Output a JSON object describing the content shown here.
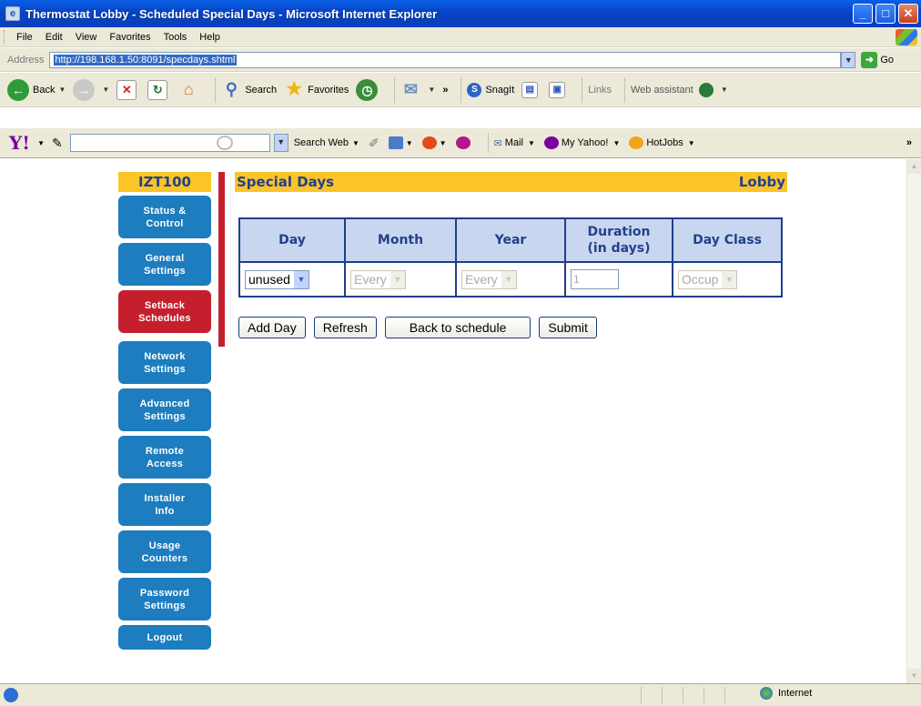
{
  "window": {
    "title": "Thermostat Lobby - Scheduled Special Days - Microsoft Internet Explorer"
  },
  "menu": [
    "File",
    "Edit",
    "View",
    "Favorites",
    "Tools",
    "Help"
  ],
  "address": {
    "label": "Address",
    "url": "http://198.168.1.50:8091/specdays.shtml",
    "go": "Go"
  },
  "toolbar": {
    "back": "Back",
    "search": "Search",
    "favorites": "Favorites",
    "more": "»",
    "snagit": "SnagIt",
    "links": "Links",
    "web_assistant": "Web assistant"
  },
  "yahoo": {
    "search_web": "Search Web",
    "mail": "Mail",
    "my_yahoo": "My Yahoo!",
    "hotjobs": "HotJobs",
    "more": "»"
  },
  "nav": {
    "device": "IZT100",
    "items": [
      {
        "line1": "Status &",
        "line2": "Control"
      },
      {
        "line1": "General",
        "line2": "Settings"
      },
      {
        "line1": "Setback",
        "line2": "Schedules"
      },
      {
        "line1": "Network",
        "line2": "Settings"
      },
      {
        "line1": "Advanced",
        "line2": "Settings"
      },
      {
        "line1": "Remote",
        "line2": "Access"
      },
      {
        "line1": "Installer",
        "line2": "Info"
      },
      {
        "line1": "Usage",
        "line2": "Counters"
      },
      {
        "line1": "Password",
        "line2": "Settings"
      },
      {
        "line1": "Logout"
      }
    ]
  },
  "page": {
    "title": "Special Days",
    "location": "Lobby"
  },
  "table": {
    "headers": {
      "day": "Day",
      "month": "Month",
      "year": "Year",
      "duration1": "Duration",
      "duration2": "(in days)",
      "day_class": "Day Class"
    },
    "row": {
      "day": "unused",
      "month": "Every",
      "year": "Every",
      "duration": "1",
      "day_class": "Occup"
    }
  },
  "buttons": {
    "add_day": "Add Day",
    "refresh": "Refresh",
    "back_to_schedule": "Back to schedule",
    "submit": "Submit"
  },
  "status": {
    "zone": "Internet"
  }
}
